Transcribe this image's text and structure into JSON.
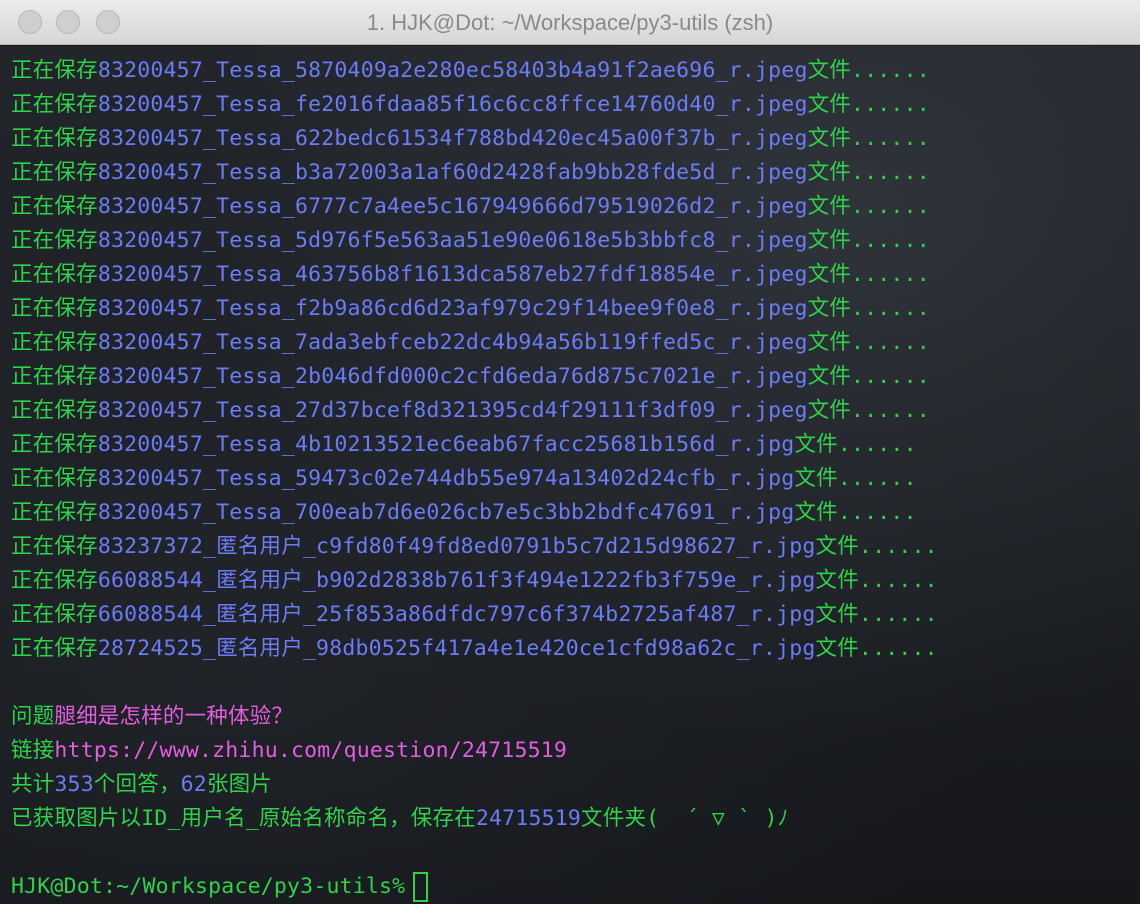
{
  "window": {
    "title": "1. HJK@Dot: ~/Workspace/py3-utils (zsh)"
  },
  "save_lines": [
    {
      "prefix": "正在保存",
      "filename": "83200457_Tessa_5870409a2e280ec58403b4a91f2ae696_r.jpeg",
      "suffix": "文件......"
    },
    {
      "prefix": "正在保存",
      "filename": "83200457_Tessa_fe2016fdaa85f16c6cc8ffce14760d40_r.jpeg",
      "suffix": "文件......"
    },
    {
      "prefix": "正在保存",
      "filename": "83200457_Tessa_622bedc61534f788bd420ec45a00f37b_r.jpeg",
      "suffix": "文件......"
    },
    {
      "prefix": "正在保存",
      "filename": "83200457_Tessa_b3a72003a1af60d2428fab9bb28fde5d_r.jpeg",
      "suffix": "文件......"
    },
    {
      "prefix": "正在保存",
      "filename": "83200457_Tessa_6777c7a4ee5c167949666d79519026d2_r.jpeg",
      "suffix": "文件......"
    },
    {
      "prefix": "正在保存",
      "filename": "83200457_Tessa_5d976f5e563aa51e90e0618e5b3bbfc8_r.jpeg",
      "suffix": "文件......"
    },
    {
      "prefix": "正在保存",
      "filename": "83200457_Tessa_463756b8f1613dca587eb27fdf18854e_r.jpeg",
      "suffix": "文件......"
    },
    {
      "prefix": "正在保存",
      "filename": "83200457_Tessa_f2b9a86cd6d23af979c29f14bee9f0e8_r.jpeg",
      "suffix": "文件......"
    },
    {
      "prefix": "正在保存",
      "filename": "83200457_Tessa_7ada3ebfceb22dc4b94a56b119ffed5c_r.jpeg",
      "suffix": "文件......"
    },
    {
      "prefix": "正在保存",
      "filename": "83200457_Tessa_2b046dfd000c2cfd6eda76d875c7021e_r.jpeg",
      "suffix": "文件......"
    },
    {
      "prefix": "正在保存",
      "filename": "83200457_Tessa_27d37bcef8d321395cd4f29111f3df09_r.jpeg",
      "suffix": "文件......"
    },
    {
      "prefix": "正在保存",
      "filename": "83200457_Tessa_4b10213521ec6eab67facc25681b156d_r.jpg",
      "suffix": "文件......"
    },
    {
      "prefix": "正在保存",
      "filename": "83200457_Tessa_59473c02e744db55e974a13402d24cfb_r.jpg",
      "suffix": "文件......"
    },
    {
      "prefix": "正在保存",
      "filename": "83200457_Tessa_700eab7d6e026cb7e5c3bb2bdfc47691_r.jpg",
      "suffix": "文件......"
    },
    {
      "prefix": "正在保存",
      "filename": "83237372_匿名用户_c9fd80f49fd8ed0791b5c7d215d98627_r.jpg",
      "suffix": "文件......"
    },
    {
      "prefix": "正在保存",
      "filename": "66088544_匿名用户_b902d2838b761f3f494e1222fb3f759e_r.jpg",
      "suffix": "文件......"
    },
    {
      "prefix": "正在保存",
      "filename": "66088544_匿名用户_25f853a86dfdc797c6f374b2725af487_r.jpg",
      "suffix": "文件......"
    },
    {
      "prefix": "正在保存",
      "filename": "28724525_匿名用户_98db0525f417a4e1e420ce1cfd98a62c_r.jpg",
      "suffix": "文件......"
    }
  ],
  "summary": {
    "question_label": "问题",
    "question_text": "腿细是怎样的一种体验？",
    "link_label": "链接",
    "link_url": "https://www.zhihu.com/question/24715519",
    "total_label": "共计",
    "answers_count": "353",
    "answers_unit": "个回答，",
    "images_count": "62",
    "images_unit": "张图片",
    "saved_prefix": "已获取图片以ID_用户名_原始名称命名，保存在",
    "folder_name": "24715519",
    "saved_suffix": "文件夹(  ´ ▽ ` )ﾉ"
  },
  "prompt": {
    "text": "HJK@Dot:~/Workspace/py3-utils%"
  },
  "colors": {
    "green": "#2fd34a",
    "blue": "#6b7cf7",
    "magenta": "#e25ee0",
    "background": "#1e1f23"
  }
}
